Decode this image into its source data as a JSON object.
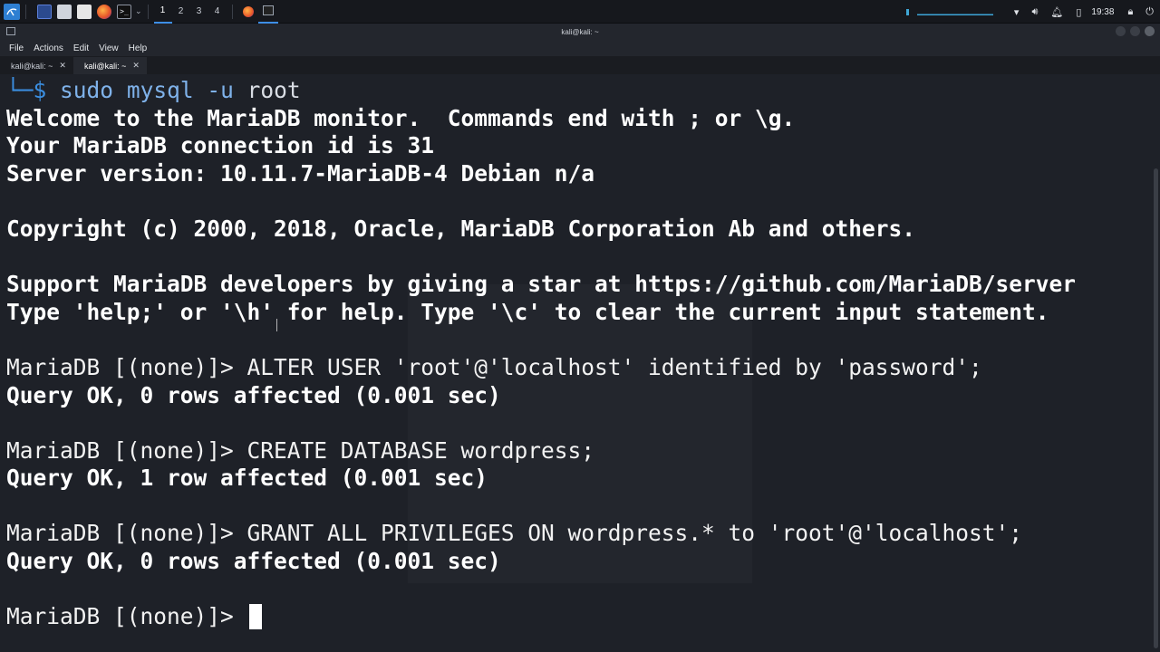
{
  "panel": {
    "workspaces": [
      "1",
      "2",
      "3",
      "4"
    ],
    "active_workspace": "1",
    "clock": "19:38",
    "tray_icons": [
      "network-icon",
      "volume-icon",
      "bell-icon",
      "battery-icon",
      "lock-icon",
      "power-icon"
    ]
  },
  "window": {
    "title": "kali@kali: ~"
  },
  "menu": [
    "File",
    "Actions",
    "Edit",
    "View",
    "Help"
  ],
  "tabs": [
    {
      "label": "kali@kali: ~",
      "active": false
    },
    {
      "label": "kali@kali: ~",
      "active": true
    }
  ],
  "terminal": {
    "prompt_corner": "└─$",
    "shell_cmd": {
      "cmd": "sudo",
      "rest1": "mysql",
      "flag": "-u",
      "arg": "root"
    },
    "welcome": "Welcome to the MariaDB monitor.  Commands end with ; or \\g.",
    "connection": "Your MariaDB connection id is 31",
    "server_version": "Server version: 10.11.7-MariaDB-4 Debian n/a",
    "copyright": "Copyright (c) 2000, 2018, Oracle, MariaDB Corporation Ab and others.",
    "support": "Support MariaDB developers by giving a star at https://github.com/MariaDB/server",
    "help": "Type 'help;' or '\\h' for help. Type '\\c' to clear the current input statement.",
    "mariadb_prompt": "MariaDB [(none)]> ",
    "cmd1": "ALTER USER 'root'@'localhost' identified by 'password';",
    "res1": "Query OK, 0 rows affected (0.001 sec)",
    "cmd2": "CREATE DATABASE wordpress;",
    "res2": "Query OK, 1 row affected (0.001 sec)",
    "cmd3": "GRANT ALL PRIVILEGES ON wordpress.* to 'root'@'localhost';",
    "res3": "Query OK, 0 rows affected (0.001 sec)"
  }
}
